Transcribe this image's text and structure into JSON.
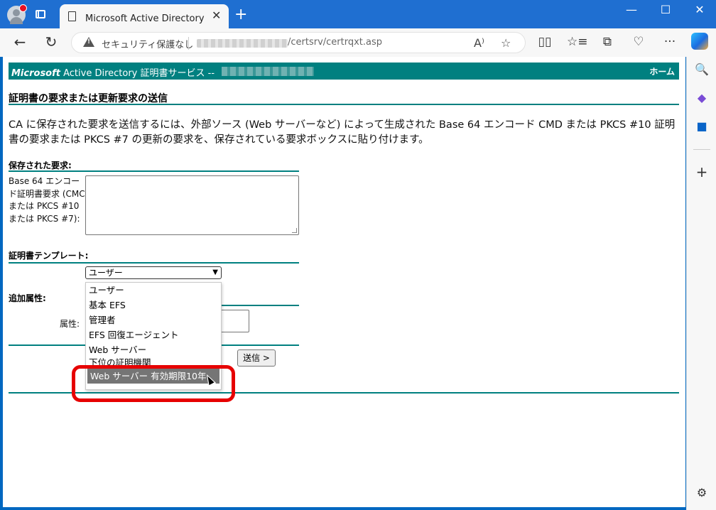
{
  "browser": {
    "tab_title": "Microsoft Active Directory 証明書",
    "tab_close": "✕",
    "new_tab": "+",
    "minimize": "—",
    "maximize": "☐",
    "close": "✕",
    "back": "←",
    "refresh": "↻",
    "security_label": "セキュリティ保護なし",
    "url_path": "/certsrv/certrqxt.asp",
    "read_aloud": "A⁾",
    "favorite": "☆",
    "more": "···"
  },
  "sidebar": {
    "search": "🔍",
    "add": "+",
    "settings": "⚙"
  },
  "page": {
    "header_brand": "Microsoft",
    "header_service": " Active Directory 証明書サービス --",
    "header_home": "ホーム",
    "title": "証明書の要求または更新要求の送信",
    "description": "CA に保存された要求を送信するには、外部ソース (Web サーバーなど) によって生成された Base 64 エンコード CMD または PKCS #10 証明書の要求または PKCS #7 の更新の要求を、保存されている要求ボックスに貼り付けます。",
    "saved_request_heading": "保存された要求:",
    "saved_request_label": "Base 64 エンコード証明書要求 (CMC または PKCS #10 または PKCS #7):",
    "template_heading": "証明書テンプレート:",
    "template_selected": "ユーザー",
    "additional_heading": "追加属性:",
    "attribute_label": "属性:",
    "submit_label": "送信 >"
  },
  "template_options": [
    "ユーザー",
    "基本 EFS",
    "管理者",
    "EFS 回復エージェント",
    "Web サーバー",
    "下位の証明機関",
    "Web サーバー 有効期限10年"
  ],
  "highlighted_option_index": 6
}
